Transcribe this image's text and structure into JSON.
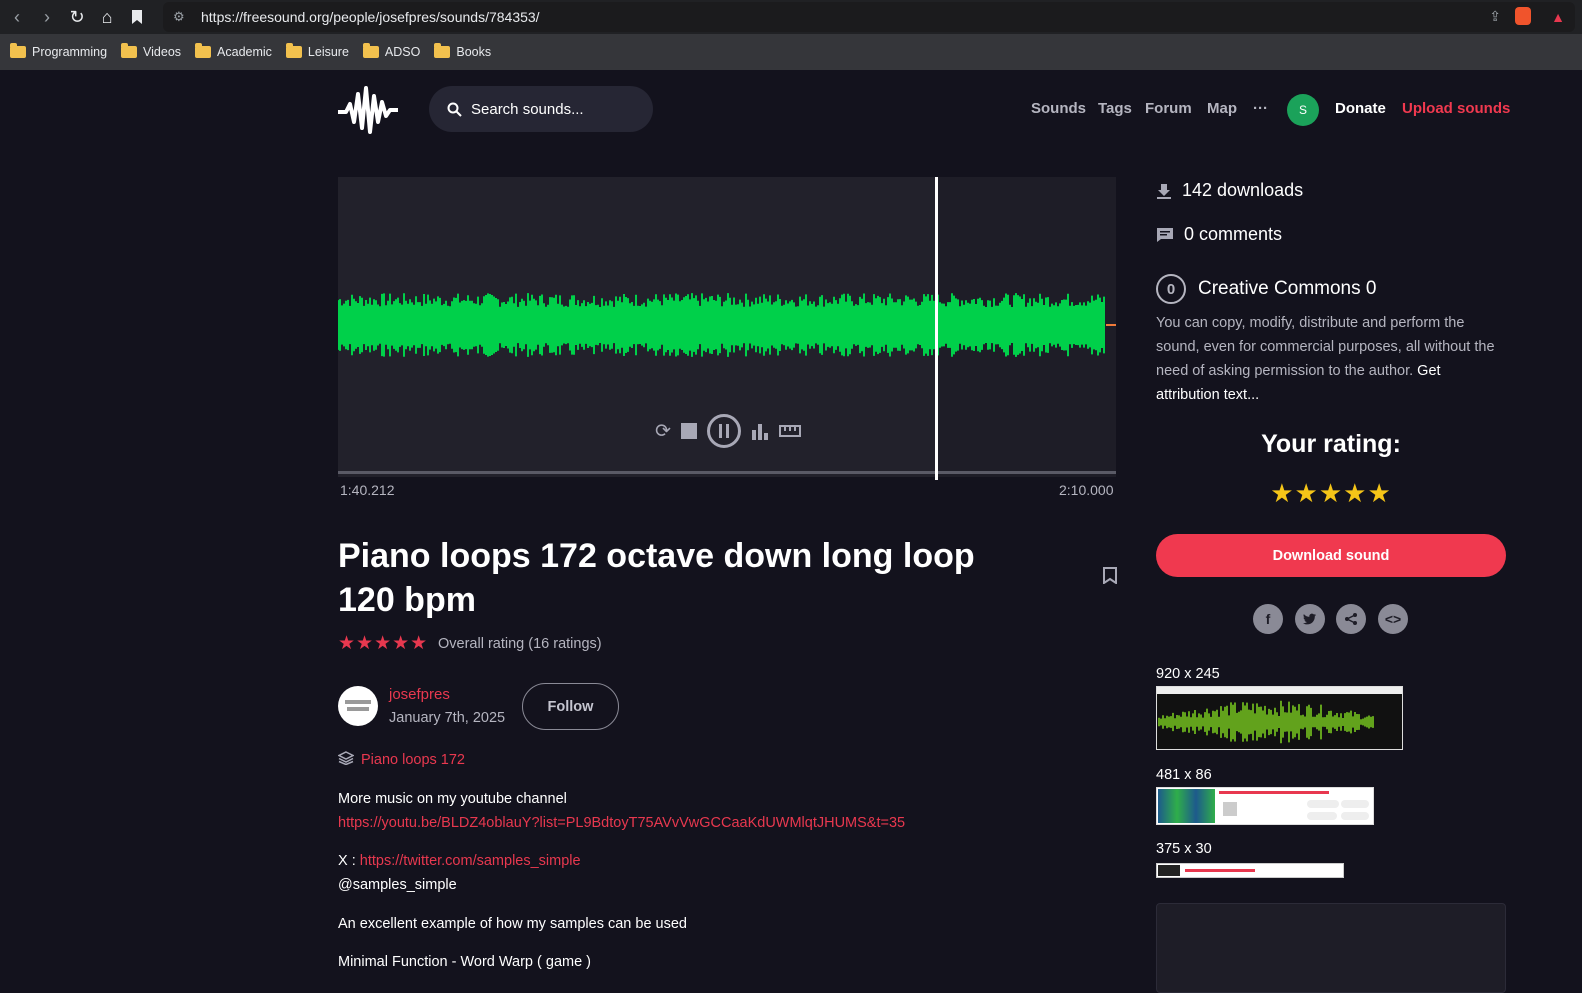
{
  "browser": {
    "url": "https://freesound.org/people/josefpres/sounds/784353/",
    "bookmarks": [
      "Programming",
      "Videos",
      "Academic",
      "Leisure",
      "ADSO",
      "Books"
    ]
  },
  "header": {
    "search_placeholder": "Search sounds...",
    "nav": [
      "Sounds",
      "Tags",
      "Forum",
      "Map"
    ],
    "more": "···",
    "avatar_letter": "S",
    "donate": "Donate",
    "upload": "Upload sounds"
  },
  "player": {
    "current_time": "1:40.212",
    "total_time": "2:10.000",
    "progress": 0.77
  },
  "sound": {
    "title": "Piano loops 172 octave down long loop 120 bpm",
    "stars": "★★★★★",
    "rating_text": "Overall rating (16 ratings)",
    "username": "josefpres",
    "date": "January 7th, 2025",
    "follow": "Follow",
    "pack": "Piano loops 172",
    "desc_1": "More music on my youtube channel",
    "desc_1_link": "https://youtu.be/BLDZ4oblauY?list=PL9BdtoyT75AVvVwGCCaaKdUWMlqtJHUMS&t=35",
    "desc_2_prefix": "X : ",
    "desc_2_link": "https://twitter.com/samples_simple",
    "desc_3": "@samples_simple",
    "desc_4": "An excellent example of how my samples can be used",
    "desc_5": "Minimal Function - Word Warp ( game )"
  },
  "sidebar": {
    "downloads": "142 downloads",
    "comments": "0 comments",
    "license_title": "Creative Commons 0",
    "license_desc": "You can copy, modify, distribute and perform the sound, even for commercial purposes, all without the need of asking permission to the author.",
    "license_link": "Get attribution text...",
    "your_rating": "Your rating:",
    "rating_stars": "★★★★★",
    "download": "Download sound",
    "embed_sizes": [
      "920 x 245",
      "481 x 86",
      "375 x 30"
    ]
  },
  "colors": {
    "accent": "#f0394f",
    "waveform": "#00d04a",
    "background": "#13121d"
  }
}
